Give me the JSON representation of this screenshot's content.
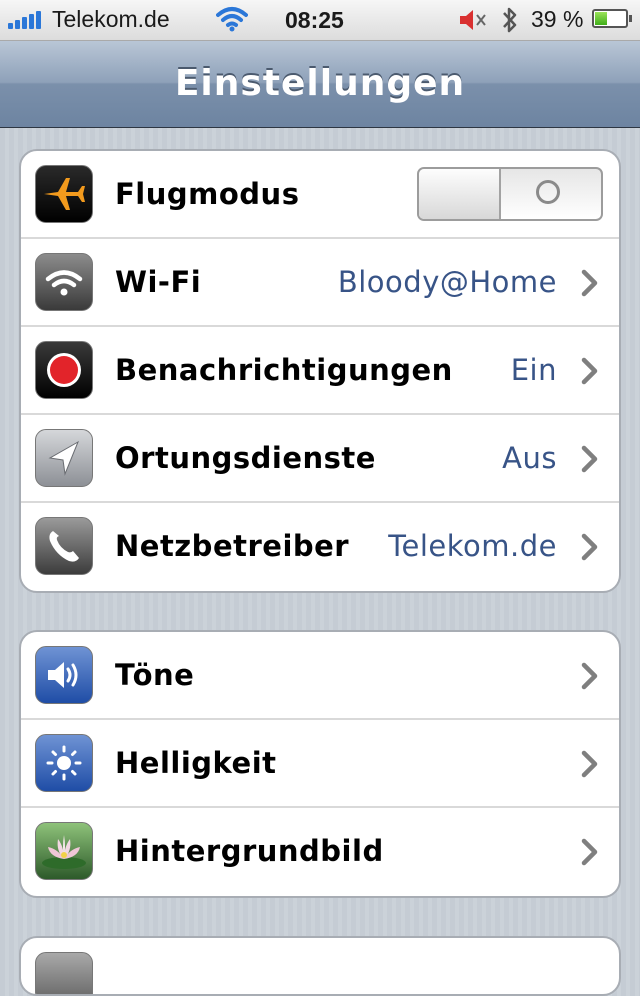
{
  "status_bar": {
    "carrier": "Telekom.de",
    "time": "08:25",
    "battery_percent": "39 %",
    "battery_level": 0.39,
    "signal_bars": 5,
    "icons": [
      "signal-icon",
      "wifi-icon",
      "speaker-muted-icon",
      "bluetooth-icon",
      "battery-icon"
    ]
  },
  "nav": {
    "title": "Einstellungen"
  },
  "groups": [
    {
      "rows": [
        {
          "label": "Flugmodus",
          "icon": "airplane-icon",
          "control": "toggle",
          "toggle_on": false
        },
        {
          "label": "Wi-Fi",
          "icon": "wifi-icon",
          "value": "Bloody@Home"
        },
        {
          "label": "Benachrichtigungen",
          "icon": "notifications-icon",
          "value": "Ein"
        },
        {
          "label": "Ortungsdienste",
          "icon": "location-icon",
          "value": "Aus"
        },
        {
          "label": "Netzbetreiber",
          "icon": "phone-icon",
          "value": "Telekom.de"
        }
      ]
    },
    {
      "rows": [
        {
          "label": "Töne",
          "icon": "sound-icon"
        },
        {
          "label": "Helligkeit",
          "icon": "brightness-icon"
        },
        {
          "label": "Hintergrundbild",
          "icon": "wallpaper-icon"
        }
      ]
    }
  ],
  "colors": {
    "value_text": "#385487",
    "nav_bar": "#7b90ab",
    "background": "#c5ccd4"
  }
}
